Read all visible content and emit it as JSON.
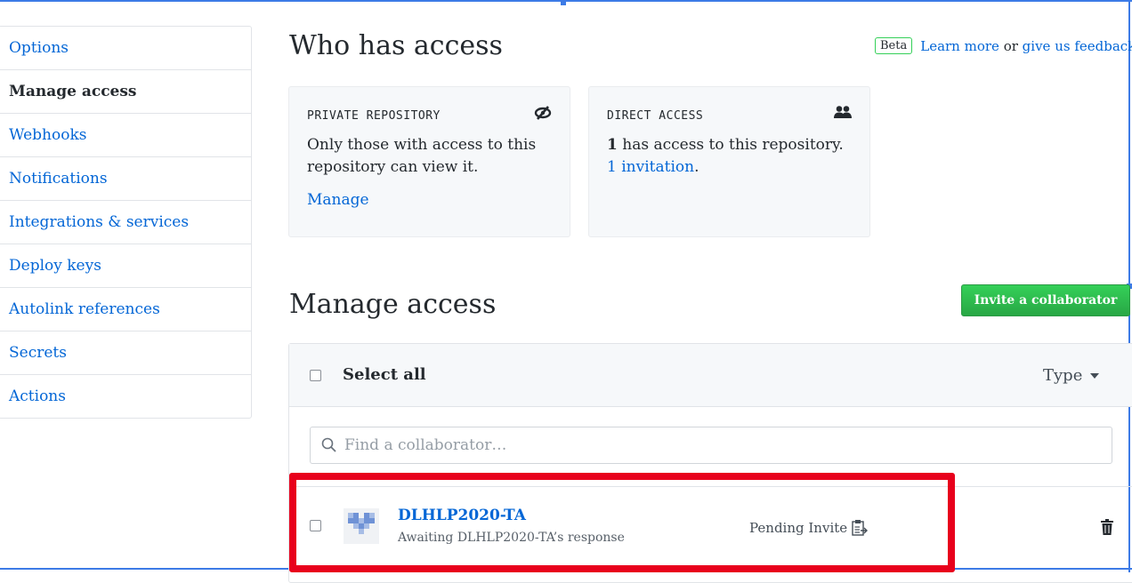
{
  "sidebar": {
    "items": [
      {
        "label": "Options"
      },
      {
        "label": "Manage access"
      },
      {
        "label": "Webhooks"
      },
      {
        "label": "Notifications"
      },
      {
        "label": "Integrations & services"
      },
      {
        "label": "Deploy keys"
      },
      {
        "label": "Autolink references"
      },
      {
        "label": "Secrets"
      },
      {
        "label": "Actions"
      }
    ],
    "active_index": 1
  },
  "who_has_access": {
    "title": "Who has access",
    "beta_badge": "Beta",
    "learn_more": "Learn more",
    "or_text": " or ",
    "feedback": "give us feedback"
  },
  "cards": {
    "private": {
      "label": "PRIVATE REPOSITORY",
      "text": "Only those with access to this repository can view it.",
      "link": "Manage",
      "icon": "eye-closed-icon"
    },
    "direct": {
      "label": "DIRECT ACCESS",
      "count": "1",
      "text": " has access to this repository.",
      "link": "1 invitation",
      "link_suffix": ".",
      "icon": "people-icon"
    }
  },
  "manage_access": {
    "title": "Manage access",
    "invite_button": "Invite a collaborator",
    "select_all": "Select all",
    "type_dropdown": "Type",
    "search_placeholder": "Find a collaborator…",
    "members": [
      {
        "name": "DLHLP2020-TA",
        "status": "Awaiting DLHLP2020-TA’s response",
        "pending": "Pending Invite"
      }
    ]
  },
  "colors": {
    "link": "#0366d6",
    "invite_green": "#28a745",
    "highlight_red": "#e8001c",
    "frame_blue": "#3d7be6"
  }
}
